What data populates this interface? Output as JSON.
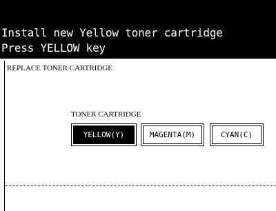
{
  "message": {
    "line1": "Install new Yellow toner cartridge",
    "line2": "Press YELLOW key"
  },
  "panel": {
    "title": "REPLACE TONER CARTRIDGE",
    "group_label": "TONER CARTRIDGE",
    "buttons": [
      {
        "label": "YELLOW(Y)",
        "selected": true
      },
      {
        "label": "MAGENTA(M)",
        "selected": false
      },
      {
        "label": "CYAN(C)",
        "selected": false
      }
    ]
  },
  "colors": {
    "message_background": "#000000",
    "message_text": "#ffffff",
    "selected_button_background": "#000000",
    "selected_button_text": "#ffffff"
  }
}
